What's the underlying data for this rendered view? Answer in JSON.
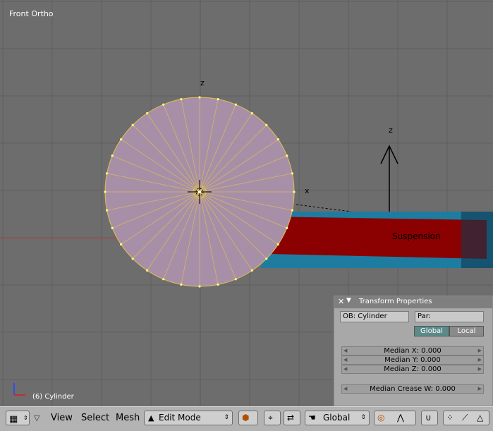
{
  "viewport": {
    "view_label": "Front Ortho",
    "object_label": "(6) Cylinder",
    "axis_z_label": "z",
    "axis_x_label": "x",
    "object_text": "Suspension",
    "colors": {
      "background": "#6d6d6d",
      "grid": "#5f5f5f",
      "mesh_fill": "#a88fa8",
      "mesh_edge": "#e0c050",
      "red_bar": "#8b0000",
      "blue_bar": "#1e7ca0"
    }
  },
  "transform_panel": {
    "title": "Transform Properties",
    "object_field": "OB: Cylinder",
    "parent_field": "Par:",
    "global_label": "Global",
    "local_label": "Local",
    "median_x": "Median X: 0.000",
    "median_y": "Median Y: 0.000",
    "median_z": "Median Z: 0.000",
    "median_crease": "Median Crease W: 0.000"
  },
  "header": {
    "menus": [
      "View",
      "Select",
      "Mesh"
    ],
    "mode_label": "Edit Mode",
    "orientation_label": "Global"
  }
}
